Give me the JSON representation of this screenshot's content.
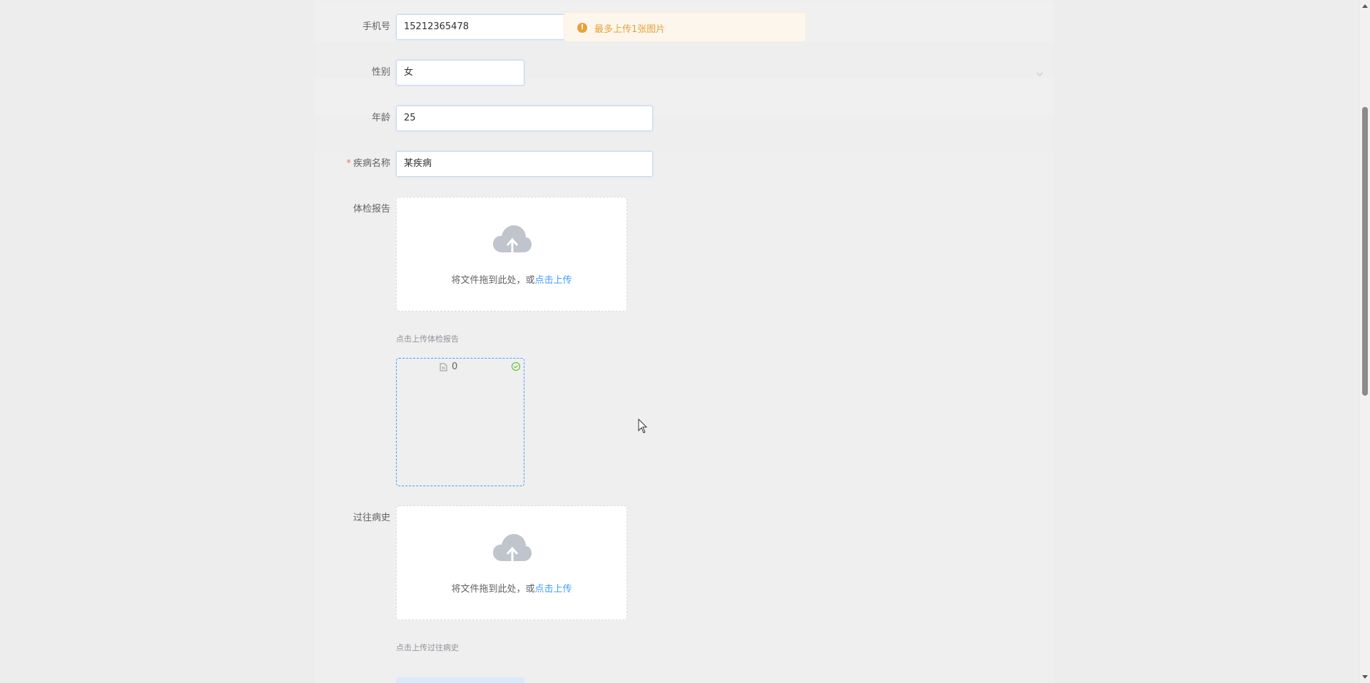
{
  "form": {
    "phone": {
      "label": "手机号",
      "value": "15212365478"
    },
    "gender": {
      "label": "性别",
      "value": "女"
    },
    "age": {
      "label": "年龄",
      "value": "25"
    },
    "disease": {
      "label": "疾病名称",
      "required_mark": "*",
      "value": "某疾病"
    },
    "checkup_report": {
      "label": "体检报告",
      "drop_text": "将文件拖到此处，或",
      "click_text": "点击上传",
      "tip": "点击上传体检报告",
      "file_name": "0"
    },
    "history": {
      "label": "过往病史",
      "drop_text": "将文件拖到此处，或",
      "click_text": "点击上传",
      "tip": "点击上传过往病史"
    }
  },
  "toast": {
    "message": "最多上传1张图片",
    "icon": "warning-icon"
  },
  "colors": {
    "link": "#409eff",
    "warning": "#e6a23c",
    "required": "#f56c6c",
    "success": "#67c23a"
  }
}
